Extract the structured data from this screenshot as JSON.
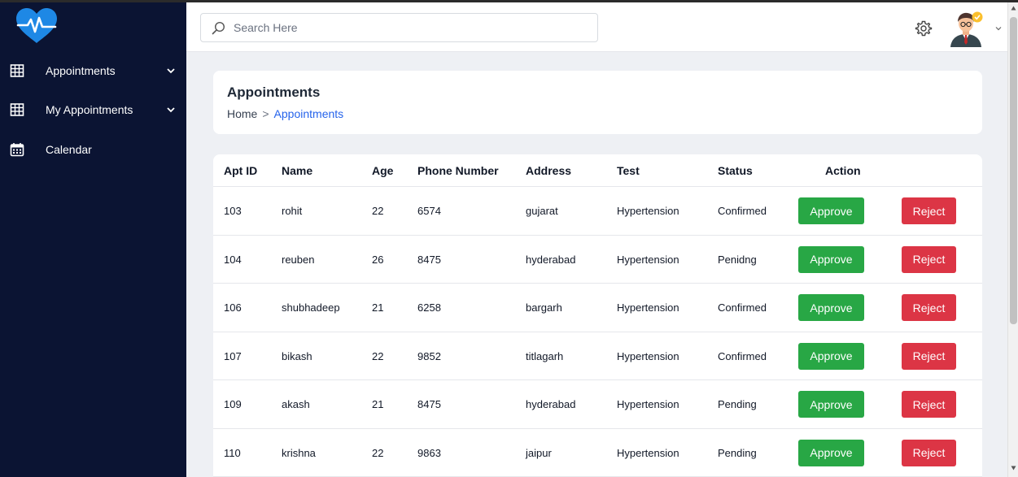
{
  "sidebar": {
    "items": [
      {
        "label": "Appointments",
        "icon": "table-grid-icon",
        "has_chevron": true
      },
      {
        "label": "My Appointments",
        "icon": "table-grid-icon",
        "has_chevron": true
      },
      {
        "label": "Calendar",
        "icon": "calendar-icon",
        "has_chevron": false
      }
    ]
  },
  "header": {
    "search_placeholder": "Search Here",
    "search_value": ""
  },
  "page": {
    "title": "Appointments",
    "breadcrumb_home": "Home",
    "breadcrumb_separator": ">",
    "breadcrumb_current": "Appointments"
  },
  "table": {
    "columns": [
      "Apt ID",
      "Name",
      "Age",
      "Phone Number",
      "Address",
      "Test",
      "Status",
      "Action"
    ],
    "rows": [
      {
        "apt_id": "103",
        "name": "rohit",
        "age": "22",
        "phone": "6574",
        "address": "gujarat",
        "test": "Hypertension",
        "status": "Confirmed"
      },
      {
        "apt_id": "104",
        "name": "reuben",
        "age": "26",
        "phone": "8475",
        "address": "hyderabad",
        "test": "Hypertension",
        "status": "Penidng"
      },
      {
        "apt_id": "106",
        "name": "shubhadeep",
        "age": "21",
        "phone": "6258",
        "address": "bargarh",
        "test": "Hypertension",
        "status": "Confirmed"
      },
      {
        "apt_id": "107",
        "name": "bikash",
        "age": "22",
        "phone": "9852",
        "address": "titlagarh",
        "test": "Hypertension",
        "status": "Confirmed"
      },
      {
        "apt_id": "109",
        "name": "akash",
        "age": "21",
        "phone": "8475",
        "address": "hyderabad",
        "test": "Hypertension",
        "status": "Pending"
      },
      {
        "apt_id": "110",
        "name": "krishna",
        "age": "22",
        "phone": "9863",
        "address": "jaipur",
        "test": "Hypertension",
        "status": "Pending"
      }
    ],
    "approve_label": "Approve",
    "reject_label": "Reject"
  },
  "colors": {
    "sidebar_bg": "#0b1433",
    "logo_blue": "#1e88e5",
    "approve": "#28a745",
    "reject": "#dc3545",
    "link": "#2563eb"
  }
}
